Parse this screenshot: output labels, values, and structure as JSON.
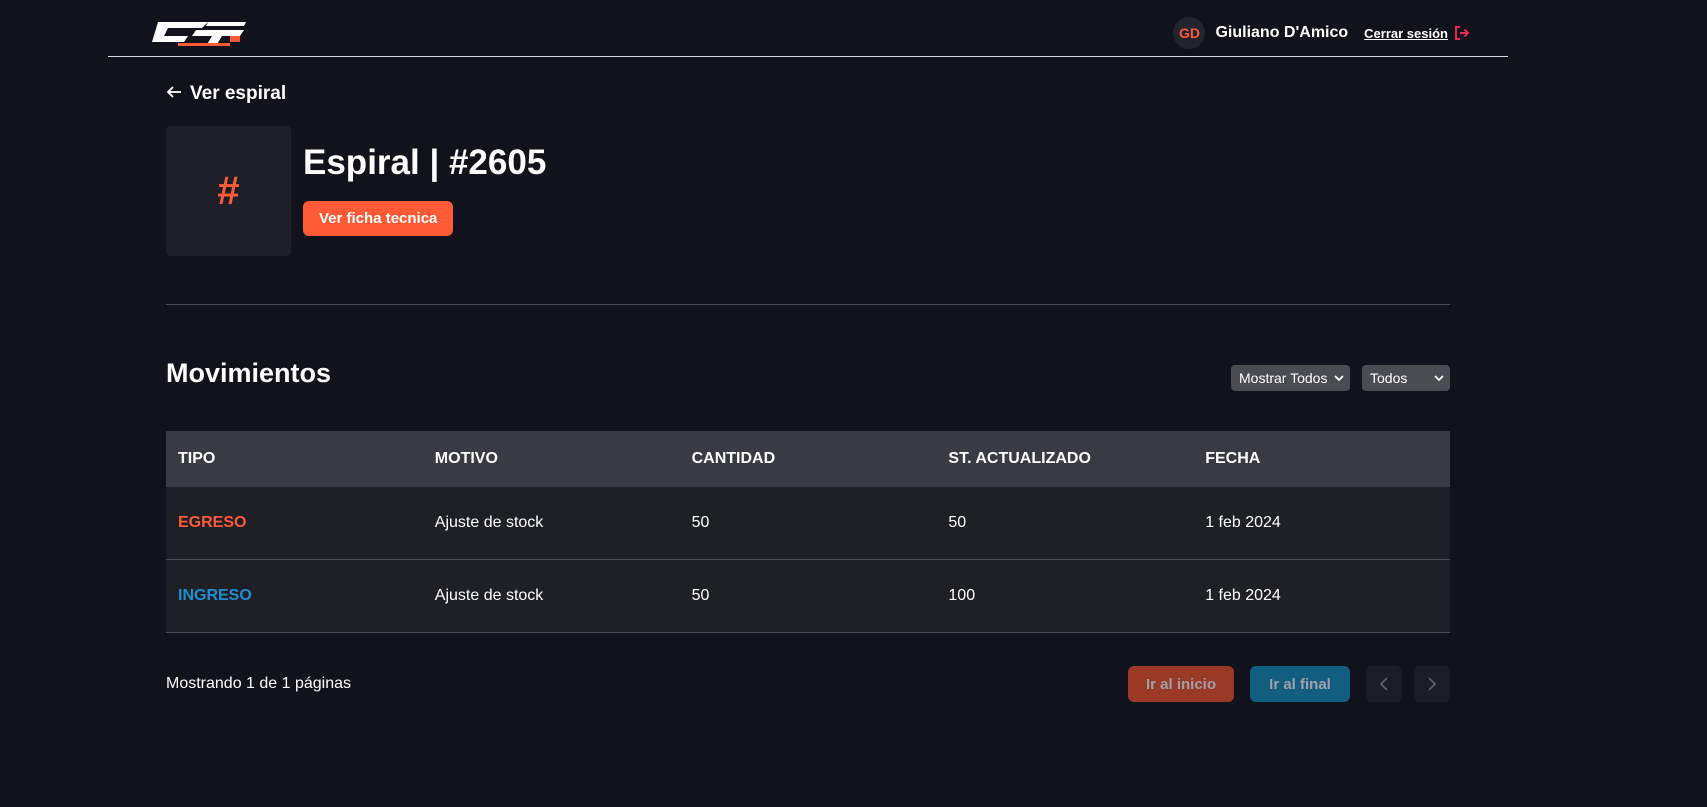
{
  "header": {
    "user_initials": "GD",
    "user_name": "Giuliano D'Amico",
    "logout_label": "Cerrar sesión"
  },
  "page": {
    "back_label": "Ver espiral",
    "thumb_symbol": "#",
    "title": "Espiral | #2605",
    "tech_sheet_button": "Ver ficha tecnica"
  },
  "movements": {
    "title": "Movimientos",
    "filter_show": "Mostrar Todos",
    "filter_type": "Todos",
    "columns": [
      "TIPO",
      "MOTIVO",
      "CANTIDAD",
      "ST. ACTUALIZADO",
      "FECHA"
    ],
    "rows": [
      {
        "tipo": "EGRESO",
        "motivo": "Ajuste de stock",
        "cantidad": "50",
        "stock": "50",
        "fecha": "1 feb 2024"
      },
      {
        "tipo": "INGRESO",
        "motivo": "Ajuste de stock",
        "cantidad": "50",
        "stock": "100",
        "fecha": "1 feb 2024"
      }
    ]
  },
  "pagination": {
    "status": "Mostrando 1 de 1 páginas",
    "first_label": "Ir al inicio",
    "last_label": "Ir al final"
  },
  "colors": {
    "background": "#11121c",
    "accent": "#ff5a36",
    "ingreso": "#1e8fd0",
    "logout_icon": "#ff2a55"
  },
  "icons": {
    "logo": "brand-logo",
    "logout": "logout-icon",
    "back": "arrow-left-icon",
    "select": "chevron-down-icon",
    "prev": "chevron-left-icon",
    "next": "chevron-right-icon"
  }
}
